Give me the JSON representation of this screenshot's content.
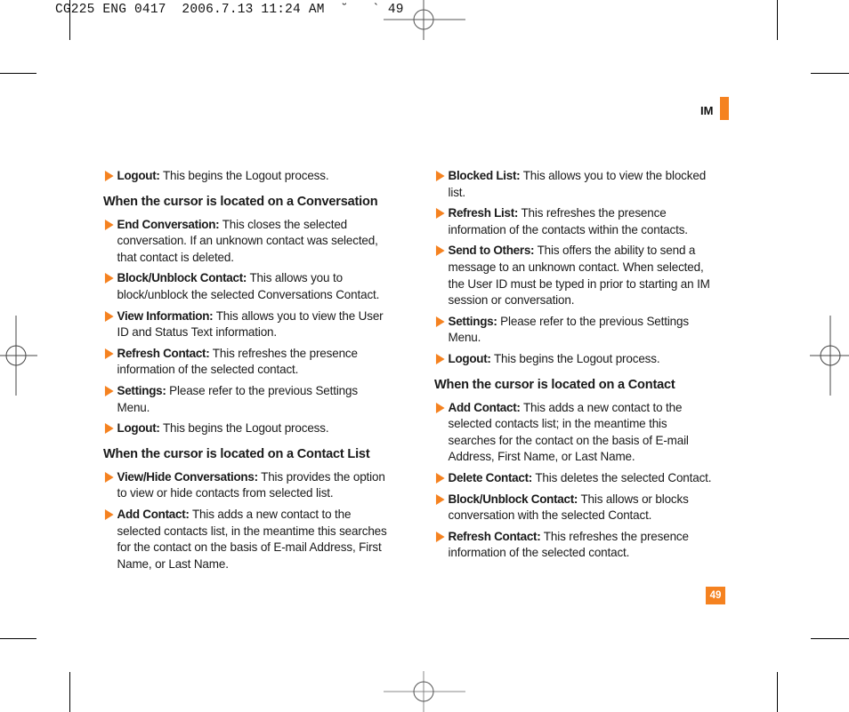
{
  "slug": {
    "text": "CG225 ENG 0417  2006.7.13 11:24 AM  ˘   ` 49"
  },
  "section_tag": "IM",
  "page_number": "49",
  "accent_color": "#f58220",
  "left_column": {
    "top_items": [
      {
        "term": "Logout:",
        "desc": " This begins the Logout process."
      }
    ],
    "sections": [
      {
        "heading": "When the cursor is located on a Conversation",
        "items": [
          {
            "term": "End Conversation:",
            "desc": " This closes the selected conversation. If an unknown contact was selected, that contact is deleted."
          },
          {
            "term": "Block/Unblock Contact:",
            "desc": " This allows you to block/unblock the selected Conversations Contact."
          },
          {
            "term": "View Information:",
            "desc": " This allows you to view the User ID and Status Text information."
          },
          {
            "term": "Refresh Contact:",
            "desc": " This refreshes the presence information of the selected contact."
          },
          {
            "term": "Settings:",
            "desc": " Please refer to the previous Settings Menu."
          },
          {
            "term": "Logout:",
            "desc": " This begins the Logout process."
          }
        ]
      },
      {
        "heading": "When the cursor is located on a Contact List",
        "items": [
          {
            "term": "View/Hide Conversations:",
            "desc": " This provides the option to view or hide contacts from selected list."
          },
          {
            "term": "Add Contact:",
            "desc": " This adds a new contact to the selected contacts list, in the meantime this searches for the contact on the basis of E-mail Address, First Name, or Last Name."
          }
        ]
      }
    ]
  },
  "right_column": {
    "top_items": [
      {
        "term": "Blocked List:",
        "desc": " This allows you to view the blocked list."
      },
      {
        "term": "Refresh List:",
        "desc": " This refreshes the presence information of the contacts within the contacts."
      },
      {
        "term": "Send to Others:",
        "desc": " This offers the ability to send a message to an unknown contact. When selected, the User ID must be typed in prior to starting an IM session or conversation."
      },
      {
        "term": "Settings:",
        "desc": " Please refer to the previous Settings Menu."
      },
      {
        "term": "Logout:",
        "desc": " This begins the Logout process."
      }
    ],
    "sections": [
      {
        "heading": "When the cursor is located on a Contact",
        "items": [
          {
            "term": "Add Contact:",
            "desc": " This adds a new contact to the selected contacts list; in the meantime this searches for the contact on the basis of E-mail Address, First Name, or Last Name."
          },
          {
            "term": "Delete Contact:",
            "desc": " This deletes the selected Contact."
          },
          {
            "term": "Block/Unblock Contact:",
            "desc": " This allows or blocks conversation with the selected Contact."
          },
          {
            "term": "Refresh Contact:",
            "desc": " This refreshes the presence information of the selected contact."
          }
        ]
      }
    ]
  }
}
